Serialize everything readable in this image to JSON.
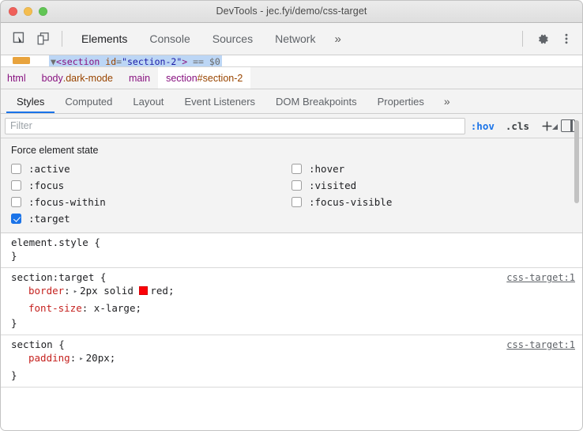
{
  "window": {
    "title": "DevTools - jec.fyi/demo/css-target",
    "traffic_lights": [
      "close-button",
      "minimize-button",
      "zoom-button"
    ]
  },
  "toolbar": {
    "inspect_icon": "inspect-cursor-icon",
    "device_icon": "device-toolbar-icon",
    "settings_icon": "gear-icon",
    "more_icon": "more-vertical-icon",
    "overflow_label": "»",
    "tabs": [
      {
        "label": "Elements",
        "active": true
      },
      {
        "label": "Console",
        "active": false
      },
      {
        "label": "Sources",
        "active": false
      },
      {
        "label": "Network",
        "active": false
      }
    ]
  },
  "dom_strip": {
    "arrow": "▼",
    "open_bracket": "<",
    "tag": "section",
    "attr_name": "id",
    "equals": "=",
    "attr_value": "\"section-2\"",
    "close_bracket": ">",
    "console_ref": "== $0"
  },
  "breadcrumb": [
    {
      "tag": "html",
      "suffix": "",
      "selected": false
    },
    {
      "tag": "body",
      "suffix": ".dark-mode",
      "selected": false
    },
    {
      "tag": "main",
      "suffix": "",
      "selected": false
    },
    {
      "tag": "section",
      "suffix": "#section-2",
      "selected": true
    }
  ],
  "pane_tabs": {
    "items": [
      {
        "label": "Styles",
        "active": true
      },
      {
        "label": "Computed",
        "active": false
      },
      {
        "label": "Layout",
        "active": false
      },
      {
        "label": "Event Listeners",
        "active": false
      },
      {
        "label": "DOM Breakpoints",
        "active": false
      },
      {
        "label": "Properties",
        "active": false
      }
    ],
    "overflow_label": "»"
  },
  "filter_bar": {
    "placeholder": "Filter",
    "value": "",
    "hov_label": ":hov",
    "hov_active": true,
    "cls_label": ".cls",
    "new_rule_label": "+",
    "panel_toggle_icon": "toggle-sidebar-icon"
  },
  "force_state": {
    "title": "Force element state",
    "items": [
      {
        "label": ":active",
        "checked": false
      },
      {
        "label": ":hover",
        "checked": false
      },
      {
        "label": ":focus",
        "checked": false
      },
      {
        "label": ":visited",
        "checked": false
      },
      {
        "label": ":focus-within",
        "checked": false
      },
      {
        "label": ":focus-visible",
        "checked": false
      },
      {
        "label": ":target",
        "checked": true
      }
    ]
  },
  "rules": [
    {
      "selector": "element.style {",
      "origin": "",
      "declarations": [],
      "close": "}"
    },
    {
      "selector": "section:target {",
      "origin": "css-target:1",
      "declarations": [
        {
          "property": "border",
          "colon": ":",
          "disclosure": "▸",
          "value": "2px solid",
          "swatch": "#fb0007",
          "value_after": "red;"
        },
        {
          "property": "font-size",
          "colon": ":",
          "disclosure": "",
          "value": "x-large;",
          "swatch": "",
          "value_after": ""
        }
      ],
      "close": "}"
    },
    {
      "selector": "section {",
      "origin": "css-target:1",
      "declarations": [
        {
          "property": "padding",
          "colon": ":",
          "disclosure": "▸",
          "value": "20px;",
          "swatch": "",
          "value_after": ""
        }
      ],
      "close": "}"
    }
  ],
  "colors": {
    "accent": "#1a73e8",
    "property": "#c5221f",
    "tag": "#881280",
    "attribute": "#994500",
    "swatch_red": "#fb0007"
  }
}
